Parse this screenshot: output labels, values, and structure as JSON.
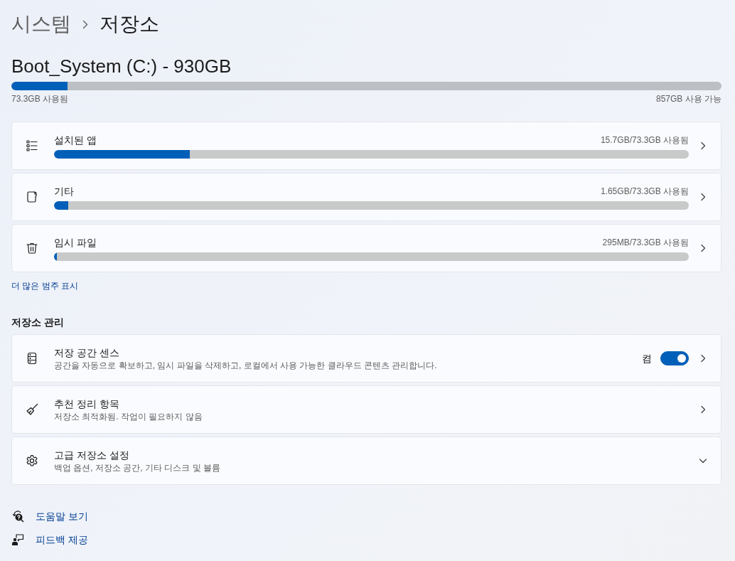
{
  "breadcrumb": [
    {
      "label": "시스템",
      "current": false
    },
    {
      "label": "저장소",
      "current": true
    }
  ],
  "drive": {
    "title": "Boot_System (C:) - 930GB",
    "level": 0.079,
    "used": "73.3GB 사용됨",
    "free": "857GB 사용 가능"
  },
  "categories": [
    {
      "name": "설치된 앱",
      "usage": "15.7GB/73.3GB 사용됨",
      "level": 0.214
    },
    {
      "name": "기타",
      "usage": "1.65GB/73.3GB 사용됨",
      "level": 0.0225
    },
    {
      "name": "임시 파일",
      "usage": "295MB/73.3GB 사용됨",
      "level": 0.004
    }
  ],
  "show_more_link": "더 많은 범주 표시",
  "management": {
    "heading": "저장소 관리",
    "items": [
      {
        "kind": "toggle",
        "title": "저장 공간 센스",
        "description": "공간을 자동으로 확보하고, 임시 파일을 삭제하고, 로컬에서 사용 가능한 클라우드 콘텐츠 관리합니다.",
        "toggle_label": "켬",
        "on": true
      },
      {
        "kind": "link",
        "title": "추천 정리 항목",
        "description": "저장소 최적화됨. 작업이 필요하지 않음"
      },
      {
        "kind": "expander",
        "title": "고급 저장소 설정",
        "description": "백업 옵션, 저장소 공간, 기타 디스크 및 볼륨",
        "expanded": false
      }
    ]
  },
  "footer_links": [
    "도움말 보기",
    "피드백 제공"
  ]
}
